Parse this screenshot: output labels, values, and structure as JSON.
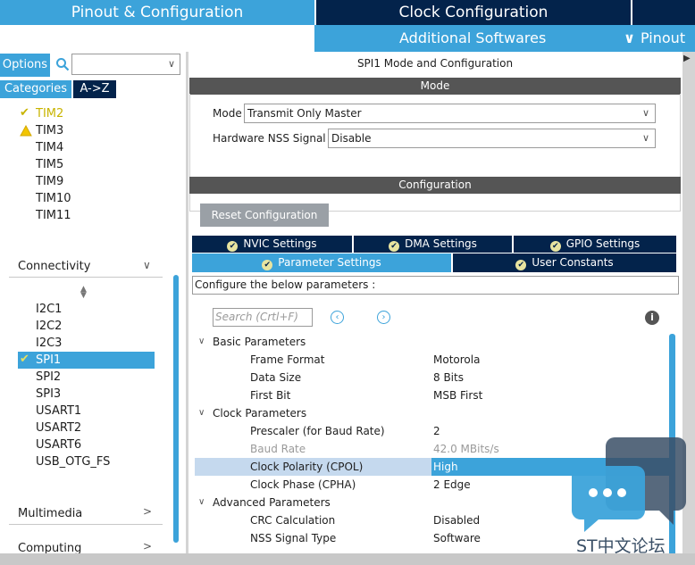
{
  "top_tabs": {
    "pinout": "Pinout & Configuration",
    "clock": "Clock Configuration"
  },
  "subbar": {
    "additional": "Additional Softwares",
    "pinout_menu": "Pinout"
  },
  "left": {
    "options": "Options",
    "categories": "Categories",
    "az": "A->Z",
    "timers": [
      {
        "label": "TIM2",
        "status": "check"
      },
      {
        "label": "TIM3",
        "status": "warning"
      },
      {
        "label": "TIM4",
        "status": ""
      },
      {
        "label": "TIM5",
        "status": ""
      },
      {
        "label": "TIM9",
        "status": ""
      },
      {
        "label": "TIM10",
        "status": ""
      },
      {
        "label": "TIM11",
        "status": ""
      }
    ],
    "connectivity": "Connectivity",
    "connectivity_items": [
      {
        "label": "I2C1",
        "status": ""
      },
      {
        "label": "I2C2",
        "status": ""
      },
      {
        "label": "I2C3",
        "status": ""
      },
      {
        "label": "SPI1",
        "status": "check",
        "selected": true
      },
      {
        "label": "SPI2",
        "status": ""
      },
      {
        "label": "SPI3",
        "status": ""
      },
      {
        "label": "USART1",
        "status": ""
      },
      {
        "label": "USART2",
        "status": ""
      },
      {
        "label": "USART6",
        "status": ""
      },
      {
        "label": "USB_OTG_FS",
        "status": ""
      }
    ],
    "multimedia": "Multimedia",
    "computing": "Computing"
  },
  "right": {
    "title": "SPI1 Mode and Configuration",
    "mode_header": "Mode",
    "mode_label": "Mode",
    "mode_value": "Transmit Only Master",
    "nss_label": "Hardware NSS Signal",
    "nss_value": "Disable",
    "config_header": "Configuration",
    "reset": "Reset Configuration",
    "tabs": {
      "nvic": "NVIC Settings",
      "dma": "DMA Settings",
      "gpio": "GPIO Settings",
      "params": "Parameter Settings",
      "user": "User Constants"
    },
    "hint": "Configure the below parameters :",
    "search_placeholder": "Search (Crtl+F)",
    "groups": {
      "basic": "Basic Parameters",
      "clock": "Clock Parameters",
      "advanced": "Advanced Parameters"
    },
    "params": {
      "frame_format": {
        "name": "Frame Format",
        "value": "Motorola"
      },
      "data_size": {
        "name": "Data Size",
        "value": "8 Bits"
      },
      "first_bit": {
        "name": "First Bit",
        "value": "MSB First"
      },
      "prescaler": {
        "name": "Prescaler (for Baud Rate)",
        "value": "2"
      },
      "baud_rate": {
        "name": "Baud Rate",
        "value": "42.0 MBits/s"
      },
      "cpol": {
        "name": "Clock Polarity (CPOL)",
        "value": "High"
      },
      "cpha": {
        "name": "Clock Phase (CPHA)",
        "value": "2 Edge"
      },
      "crc": {
        "name": "CRC Calculation",
        "value": "Disabled"
      },
      "nss_type": {
        "name": "NSS Signal Type",
        "value": "Software"
      }
    }
  },
  "watermark": "ST中文论坛",
  "colors": {
    "accent": "#3ca3da",
    "dark": "#03234b",
    "header_gray": "#555555"
  }
}
